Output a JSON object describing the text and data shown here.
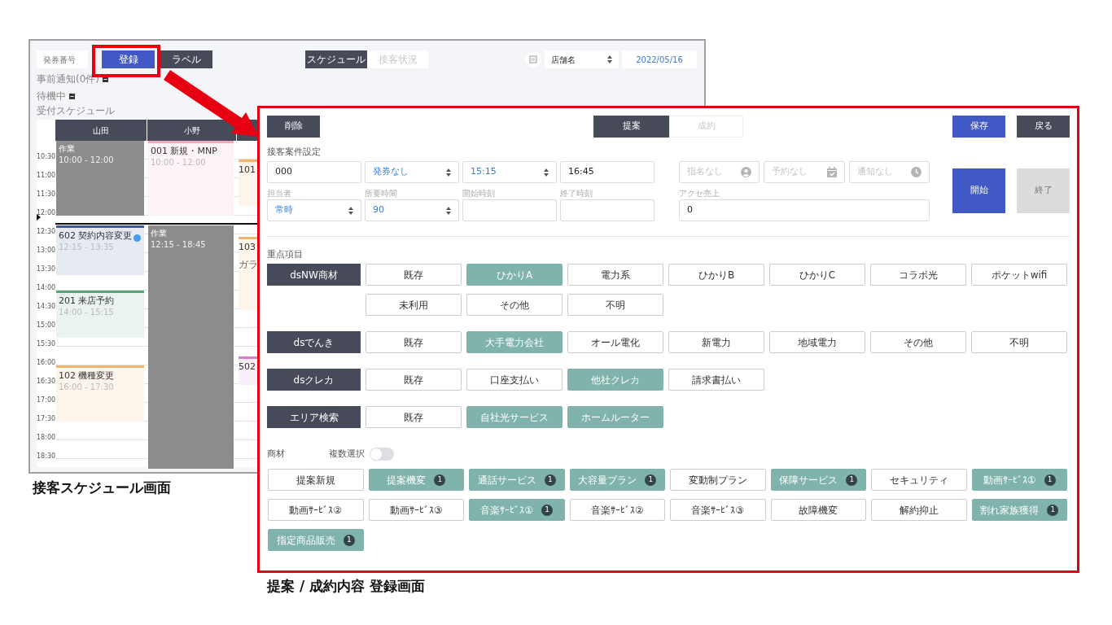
{
  "schedule_screen": {
    "caption": "接客スケジュール画面",
    "ticket_field": {
      "placeholder": "発券番号"
    },
    "buttons": [
      {
        "label": "登録",
        "kind": "primary"
      },
      {
        "label": "ラベル",
        "kind": "dark"
      }
    ],
    "view_tabs": [
      {
        "label": "スケジュール",
        "selected": true
      },
      {
        "label": "接客状況",
        "selected": false
      }
    ],
    "store_select": {
      "value": "店舗名"
    },
    "date": "2022/05/16",
    "sections": [
      {
        "label": "事前通知(0件)"
      },
      {
        "label": "待機中"
      }
    ],
    "schedule_title": "受付スケジュール",
    "time_labels": [
      "10:30",
      "11:00",
      "11:30",
      "12:00",
      "12:30",
      "13:00",
      "13:30",
      "14:00",
      "14:30",
      "15:00",
      "15:30",
      "16:00",
      "16:30",
      "17:00",
      "17:30",
      "18:00",
      "18:30"
    ],
    "columns": [
      {
        "name": "山田",
        "events": [
          {
            "kind": "work",
            "title": "作業",
            "time": "10:00 - 12:00",
            "color": "#8c8c8c",
            "notified": false
          },
          {
            "kind": "booking",
            "title": "602 契約内容変更",
            "time": "12:15 - 13:35",
            "color": "#3f5a9a",
            "notified": true
          },
          {
            "kind": "booking",
            "title": "201 来店予約",
            "time": "14:00 - 15:15",
            "color": "#5aa57f",
            "notified": false
          },
          {
            "kind": "booking",
            "title": "102 機種変更",
            "time": "16:00 - 17:30",
            "color": "#f2b36b",
            "notified": false
          }
        ]
      },
      {
        "name": "小野",
        "events": [
          {
            "kind": "booking",
            "title": "001 新規・MNP",
            "time": "10:00 - 12:00",
            "color": "#f0a8b8",
            "notified": false
          },
          {
            "kind": "work",
            "title": "作業",
            "time": "12:15 - 18:45",
            "color": "#8c8c8c",
            "notified": false
          }
        ]
      },
      {
        "events": [
          {
            "kind": "booking",
            "title": "101",
            "color": "#f2b36b",
            "notified": false
          },
          {
            "kind": "booking",
            "title": "103",
            "note": "ガラ",
            "color": "#f2b36b",
            "notified": false
          },
          {
            "kind": "booking",
            "title": "502",
            "color": "#d77fc6",
            "notified": false
          }
        ]
      }
    ]
  },
  "registration_screen": {
    "caption": "提案 / 成約内容 登録画面",
    "delete_button": "削除",
    "mode_tabs": [
      {
        "label": "提案",
        "selected": true
      },
      {
        "label": "成約",
        "selected": false
      }
    ],
    "save_button": "保存",
    "back_button": "戻る",
    "section_title": "接客案件設定",
    "fields": [
      {
        "value": "000",
        "kind": "text"
      },
      {
        "value": "発券なし",
        "kind": "select"
      },
      {
        "value": "15:15",
        "kind": "select"
      },
      {
        "value": "16:45",
        "kind": "text"
      },
      {
        "label": "担当者",
        "value": "常時",
        "kind": "select"
      },
      {
        "label": "所要時間",
        "value": "90",
        "kind": "select"
      },
      {
        "label": "開始時刻",
        "kind": "text"
      },
      {
        "label": "終了時刻",
        "kind": "text"
      }
    ],
    "status_fields": [
      {
        "placeholder": "指名なし"
      },
      {
        "placeholder": "予約なし"
      },
      {
        "placeholder": "通知なし"
      }
    ],
    "accessory_sales": {
      "label": "アクセ売上",
      "value": "0"
    },
    "start_button": {
      "label": "開始",
      "disabled": false
    },
    "end_button": {
      "label": "終了",
      "disabled": true
    },
    "focus_title": "重点項目",
    "focus_groups": [
      {
        "name": "dsNW商材",
        "options": [
          {
            "label": "既存",
            "selected": false
          },
          {
            "label": "ひかりA",
            "selected": true
          },
          {
            "label": "電力系",
            "selected": false
          },
          {
            "label": "ひかりB",
            "selected": false
          },
          {
            "label": "ひかりC",
            "selected": false
          },
          {
            "label": "コラボ光",
            "selected": false
          },
          {
            "label": "ポケットwifi",
            "selected": false
          },
          {
            "label": "未利用",
            "selected": false
          },
          {
            "label": "その他",
            "selected": false
          },
          {
            "label": "不明",
            "selected": false
          }
        ]
      },
      {
        "name": "dsでんき",
        "options": [
          {
            "label": "既存",
            "selected": false
          },
          {
            "label": "大手電力会社",
            "selected": true
          },
          {
            "label": "オール電化",
            "selected": false
          },
          {
            "label": "新電力",
            "selected": false
          },
          {
            "label": "地域電力",
            "selected": false
          },
          {
            "label": "その他",
            "selected": false
          },
          {
            "label": "不明",
            "selected": false
          }
        ]
      },
      {
        "name": "dsクレカ",
        "options": [
          {
            "label": "既存",
            "selected": false
          },
          {
            "label": "口座支払い",
            "selected": false
          },
          {
            "label": "他社クレカ",
            "selected": true
          },
          {
            "label": "請求書払い",
            "selected": false
          }
        ]
      },
      {
        "name": "エリア検索",
        "options": [
          {
            "label": "既存",
            "selected": false
          },
          {
            "label": "自社光サービス",
            "selected": true
          },
          {
            "label": "ホームルーター",
            "selected": true
          }
        ]
      }
    ],
    "products_title": "商材",
    "multi_select": {
      "label": "複数選択",
      "on": false
    },
    "products": [
      {
        "label": "提案新規",
        "selected": false
      },
      {
        "label": "提案機変",
        "selected": true,
        "count": "1"
      },
      {
        "label": "通話サービス",
        "selected": true,
        "count": "1"
      },
      {
        "label": "大容量プラン",
        "selected": true,
        "count": "1"
      },
      {
        "label": "変動制プラン",
        "selected": false
      },
      {
        "label": "保障サービス",
        "selected": true,
        "count": "1"
      },
      {
        "label": "セキュリティ",
        "selected": false
      },
      {
        "label": "動画ｻｰﾋﾞｽ①",
        "selected": true,
        "count": "1"
      },
      {
        "label": "動画ｻｰﾋﾞｽ②",
        "selected": false
      },
      {
        "label": "動画ｻｰﾋﾞｽ③",
        "selected": false
      },
      {
        "label": "音楽ｻｰﾋﾞｽ①",
        "selected": true,
        "count": "1"
      },
      {
        "label": "音楽ｻｰﾋﾞｽ②",
        "selected": false
      },
      {
        "label": "音楽ｻｰﾋﾞｽ③",
        "selected": false
      },
      {
        "label": "故障機変",
        "selected": false
      },
      {
        "label": "解約抑止",
        "selected": false
      },
      {
        "label": "割れ家族獲得",
        "selected": true,
        "count": "1"
      },
      {
        "label": "指定商品販売",
        "selected": true,
        "count": "1"
      }
    ]
  }
}
